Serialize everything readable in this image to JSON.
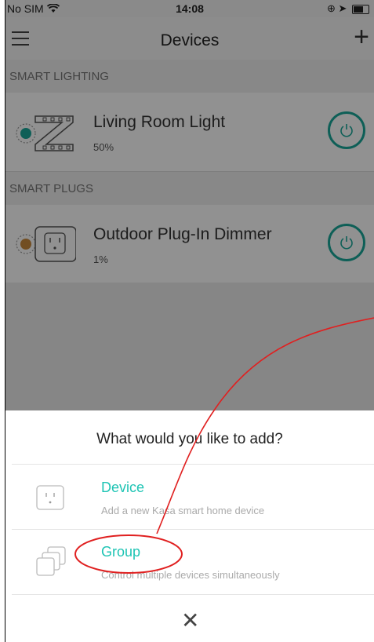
{
  "status_bar": {
    "carrier": "No SIM",
    "time": "14:08"
  },
  "nav": {
    "title": "Devices"
  },
  "sections": [
    {
      "header": "SMART LIGHTING",
      "device": {
        "name": "Living Room Light",
        "level": "50%"
      }
    },
    {
      "header": "SMART PLUGS",
      "device": {
        "name": "Outdoor Plug-In Dimmer",
        "level": "1%"
      }
    }
  ],
  "sheet": {
    "title": "What would you like to add?",
    "options": [
      {
        "label": "Device",
        "description": "Add a new Kasa smart home device"
      },
      {
        "label": "Group",
        "description": "Control multiple devices simultaneously"
      }
    ]
  },
  "colors": {
    "accent": "#1ec4b4",
    "power": "#1aa89a",
    "annotation": "#e02020"
  },
  "icons": [
    "wifi-icon",
    "battery-icon",
    "menu-icon",
    "plus-icon",
    "power-icon",
    "light-strip-icon",
    "plug-icon",
    "group-icon",
    "close-icon"
  ]
}
